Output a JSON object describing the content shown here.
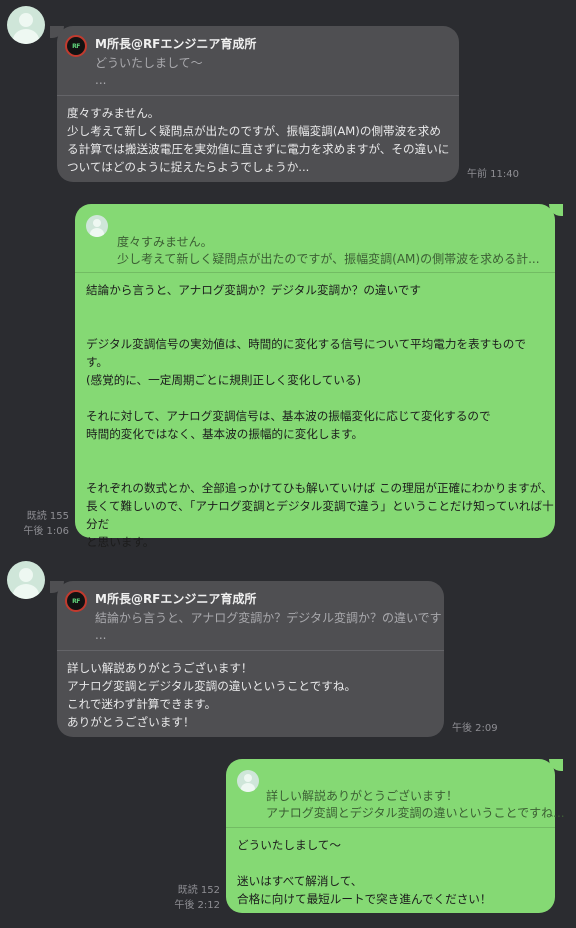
{
  "chat": {
    "messages": [
      {
        "quote": {
          "sender": "M所長@RFエンジニア育成所",
          "line1": "どういたしまして～",
          "line2": "...",
          "icon_text": "RF"
        },
        "body": "度々すみません。\n少し考えて新しく疑問点が出たのですが、振幅変調(AM)の側帯波を求め\nる計算では搬送波電圧を実効値に直さずに電力を求めますが、その違いに\nついてはどのように捉えたらようでしょうか...",
        "time": "午前 11:40"
      },
      {
        "quote": {
          "line1": "度々すみません。",
          "line2": "少し考えて新しく疑問点が出たのですが、振幅変調(AM)の側帯波を求める計..."
        },
        "body": "結論から言うと、アナログ変調か？デジタル変調か？の違いです\n\n\nデジタル変調信号の実効値は、時間的に変化する信号について平均電力を表すもので\nす。\n(感覚的に、一定周期ごとに規則正しく変化している)\n\nそれに対して、アナログ変調信号は、基本波の振幅変化に応じて変化するので\n時間的変化ではなく、基本波の振幅的に変化します。\n\n\nそれぞれの数式とか、全部追っかけてひも解いていけば この理屈が正確にわかりますが、\n長くて難しいので、「アナログ変調とデジタル変調で違う」ということだけ知っていれば十分だ\nと思います。",
        "read": "既読 155",
        "time": "午後 1:06"
      },
      {
        "quote": {
          "sender": "M所長@RFエンジニア育成所",
          "line1": "結論から言うと、アナログ変調か？デジタル変調か？の違いです",
          "line2": "...",
          "icon_text": "RF"
        },
        "body": "詳しい解説ありがとうございます！\nアナログ変調とデジタル変調の違いということですね。\nこれで迷わず計算できます。\nありがとうございます！",
        "time": "午後 2:09"
      },
      {
        "quote": {
          "line1": "詳しい解説ありがとうございます！",
          "line2": "アナログ変調とデジタル変調の違いということですね..."
        },
        "body": "どういたしまして～\n\n迷いはすべて解消して、\n合格に向けて最短ルートで突き進んでください！",
        "read": "既読 152",
        "time": "午後 2:12"
      }
    ]
  }
}
